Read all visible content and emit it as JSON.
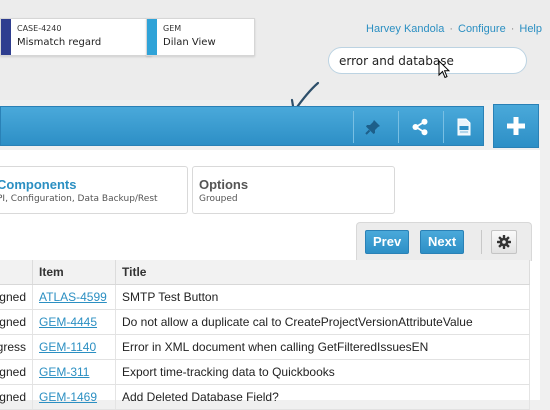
{
  "recent_cards": [
    {
      "key": "CASE-4240",
      "title": "Mismatch regard",
      "color": "#2e3d8f"
    },
    {
      "key": "GEM",
      "title": "Dilan View",
      "color": "#2fa3d8"
    }
  ],
  "top_links": {
    "user": "Harvey Kandola",
    "configure": "Configure",
    "help": "Help",
    "separator": "·"
  },
  "search": {
    "value": "error and database"
  },
  "toolbar": {
    "icons": [
      "pin-icon",
      "share-icon",
      "pdf-icon"
    ],
    "add_icon": "plus-icon",
    "accent": "#2d8fc6"
  },
  "filters": [
    {
      "title": "Components",
      "subtitle": "PI, Configuration, Data Backup/Rest"
    },
    {
      "title": "Options",
      "subtitle": "Grouped"
    }
  ],
  "pager": {
    "prev": "Prev",
    "next": "Next"
  },
  "table": {
    "columns": [
      "",
      "Item",
      "Title"
    ],
    "rows": [
      {
        "status": "gned",
        "item": "ATLAS-4599",
        "title": "SMTP Test Button"
      },
      {
        "status": "gned",
        "item": "GEM-4445",
        "title": "Do not allow a duplicate cal to CreateProjectVersionAttributeValue"
      },
      {
        "status": "gress",
        "item": "GEM-1140",
        "title": "Error in XML document when calling GetFilteredIssuesEN"
      },
      {
        "status": "gned",
        "item": "GEM-311",
        "title": "Export time-tracking data to Quickbooks"
      },
      {
        "status": "gned",
        "item": "GEM-1469",
        "title": "Add Deleted Database Field?"
      }
    ]
  }
}
